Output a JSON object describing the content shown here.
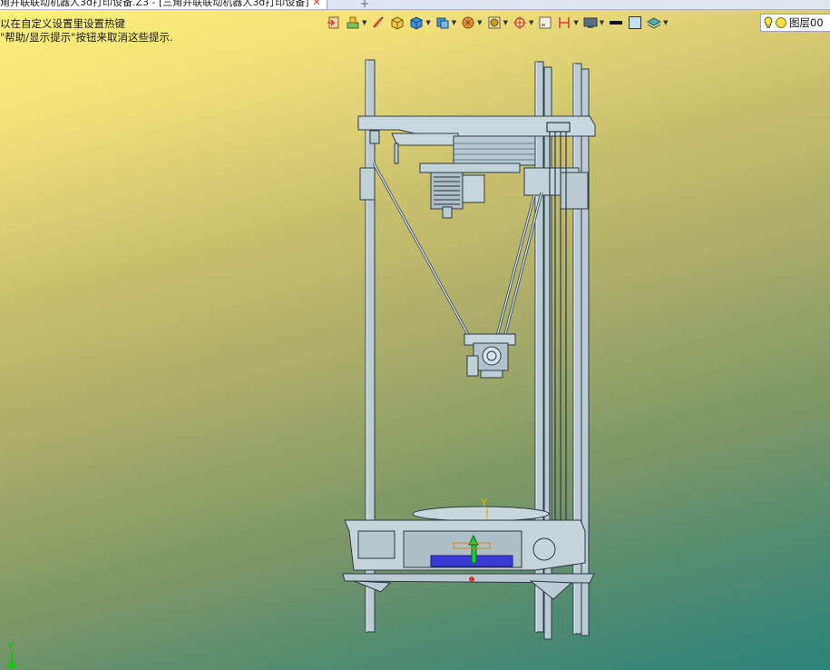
{
  "window": {
    "tab_title": "角并联联动机器人3d打印设备.Z3 - [三角并联联动机器人3d打印设备]",
    "tab_close": "✕",
    "new_tab": "+"
  },
  "hints": {
    "line1": "以在自定义设置里设置热键",
    "line2": "\"帮助/显示提示\"按钮来取消这些提示."
  },
  "toolbar": {
    "layer_label": "图层00",
    "icons": [
      "exit-icon",
      "paint-icon",
      "brush-icon",
      "box-tool-icon",
      "solid-cube-icon",
      "view-cube-icon",
      "render-mode-icon",
      "filter-icon",
      "origin-icon",
      "frame-icon",
      "dimension-icon",
      "monitor-icon",
      "line-style-icon",
      "fill-color-icon",
      "layers-icon",
      "lightbulb-icon"
    ]
  },
  "viewport": {
    "axis_y_label": "Y",
    "triad_y_label": "Y",
    "background_top": "#fdf17a",
    "background_bottom": "#2c8478",
    "model_stroke": "#2e3a44",
    "model_fill": "#b9cbd3"
  }
}
